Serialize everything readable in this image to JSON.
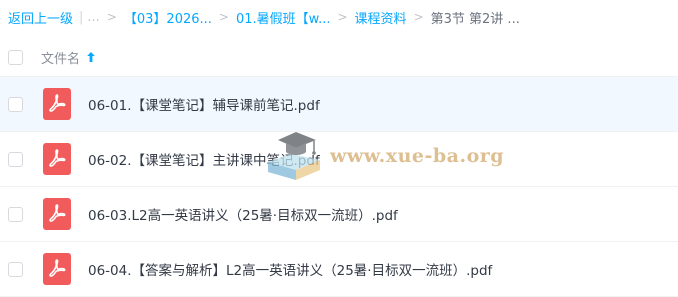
{
  "breadcrumb": {
    "back": "返回上一级",
    "pipe": "|",
    "ellipsis": "...",
    "items": [
      "【03】2026...",
      "01.暑假班【w...",
      "课程资料"
    ],
    "current": "第3节 第2讲 ..."
  },
  "table": {
    "column_header": "文件名",
    "sort_direction": "ascending",
    "rows": [
      {
        "name": "06-01.【课堂笔记】辅导课前笔记.pdf",
        "type": "pdf"
      },
      {
        "name": "06-02.【课堂笔记】主讲课中笔记.pdf",
        "type": "pdf"
      },
      {
        "name": "06-03.L2高一英语讲义（25暑·目标双一流班）.pdf",
        "type": "pdf"
      },
      {
        "name": "06-04.【答案与解析】L2高一英语讲义（25暑·目标双一流班）.pdf",
        "type": "pdf"
      }
    ]
  },
  "watermark": {
    "text": "www.xue-ba.org"
  },
  "colors": {
    "accent": "#06a7ff",
    "pdf_icon": "#f25b5b",
    "row_hover": "#f1f8ff"
  }
}
